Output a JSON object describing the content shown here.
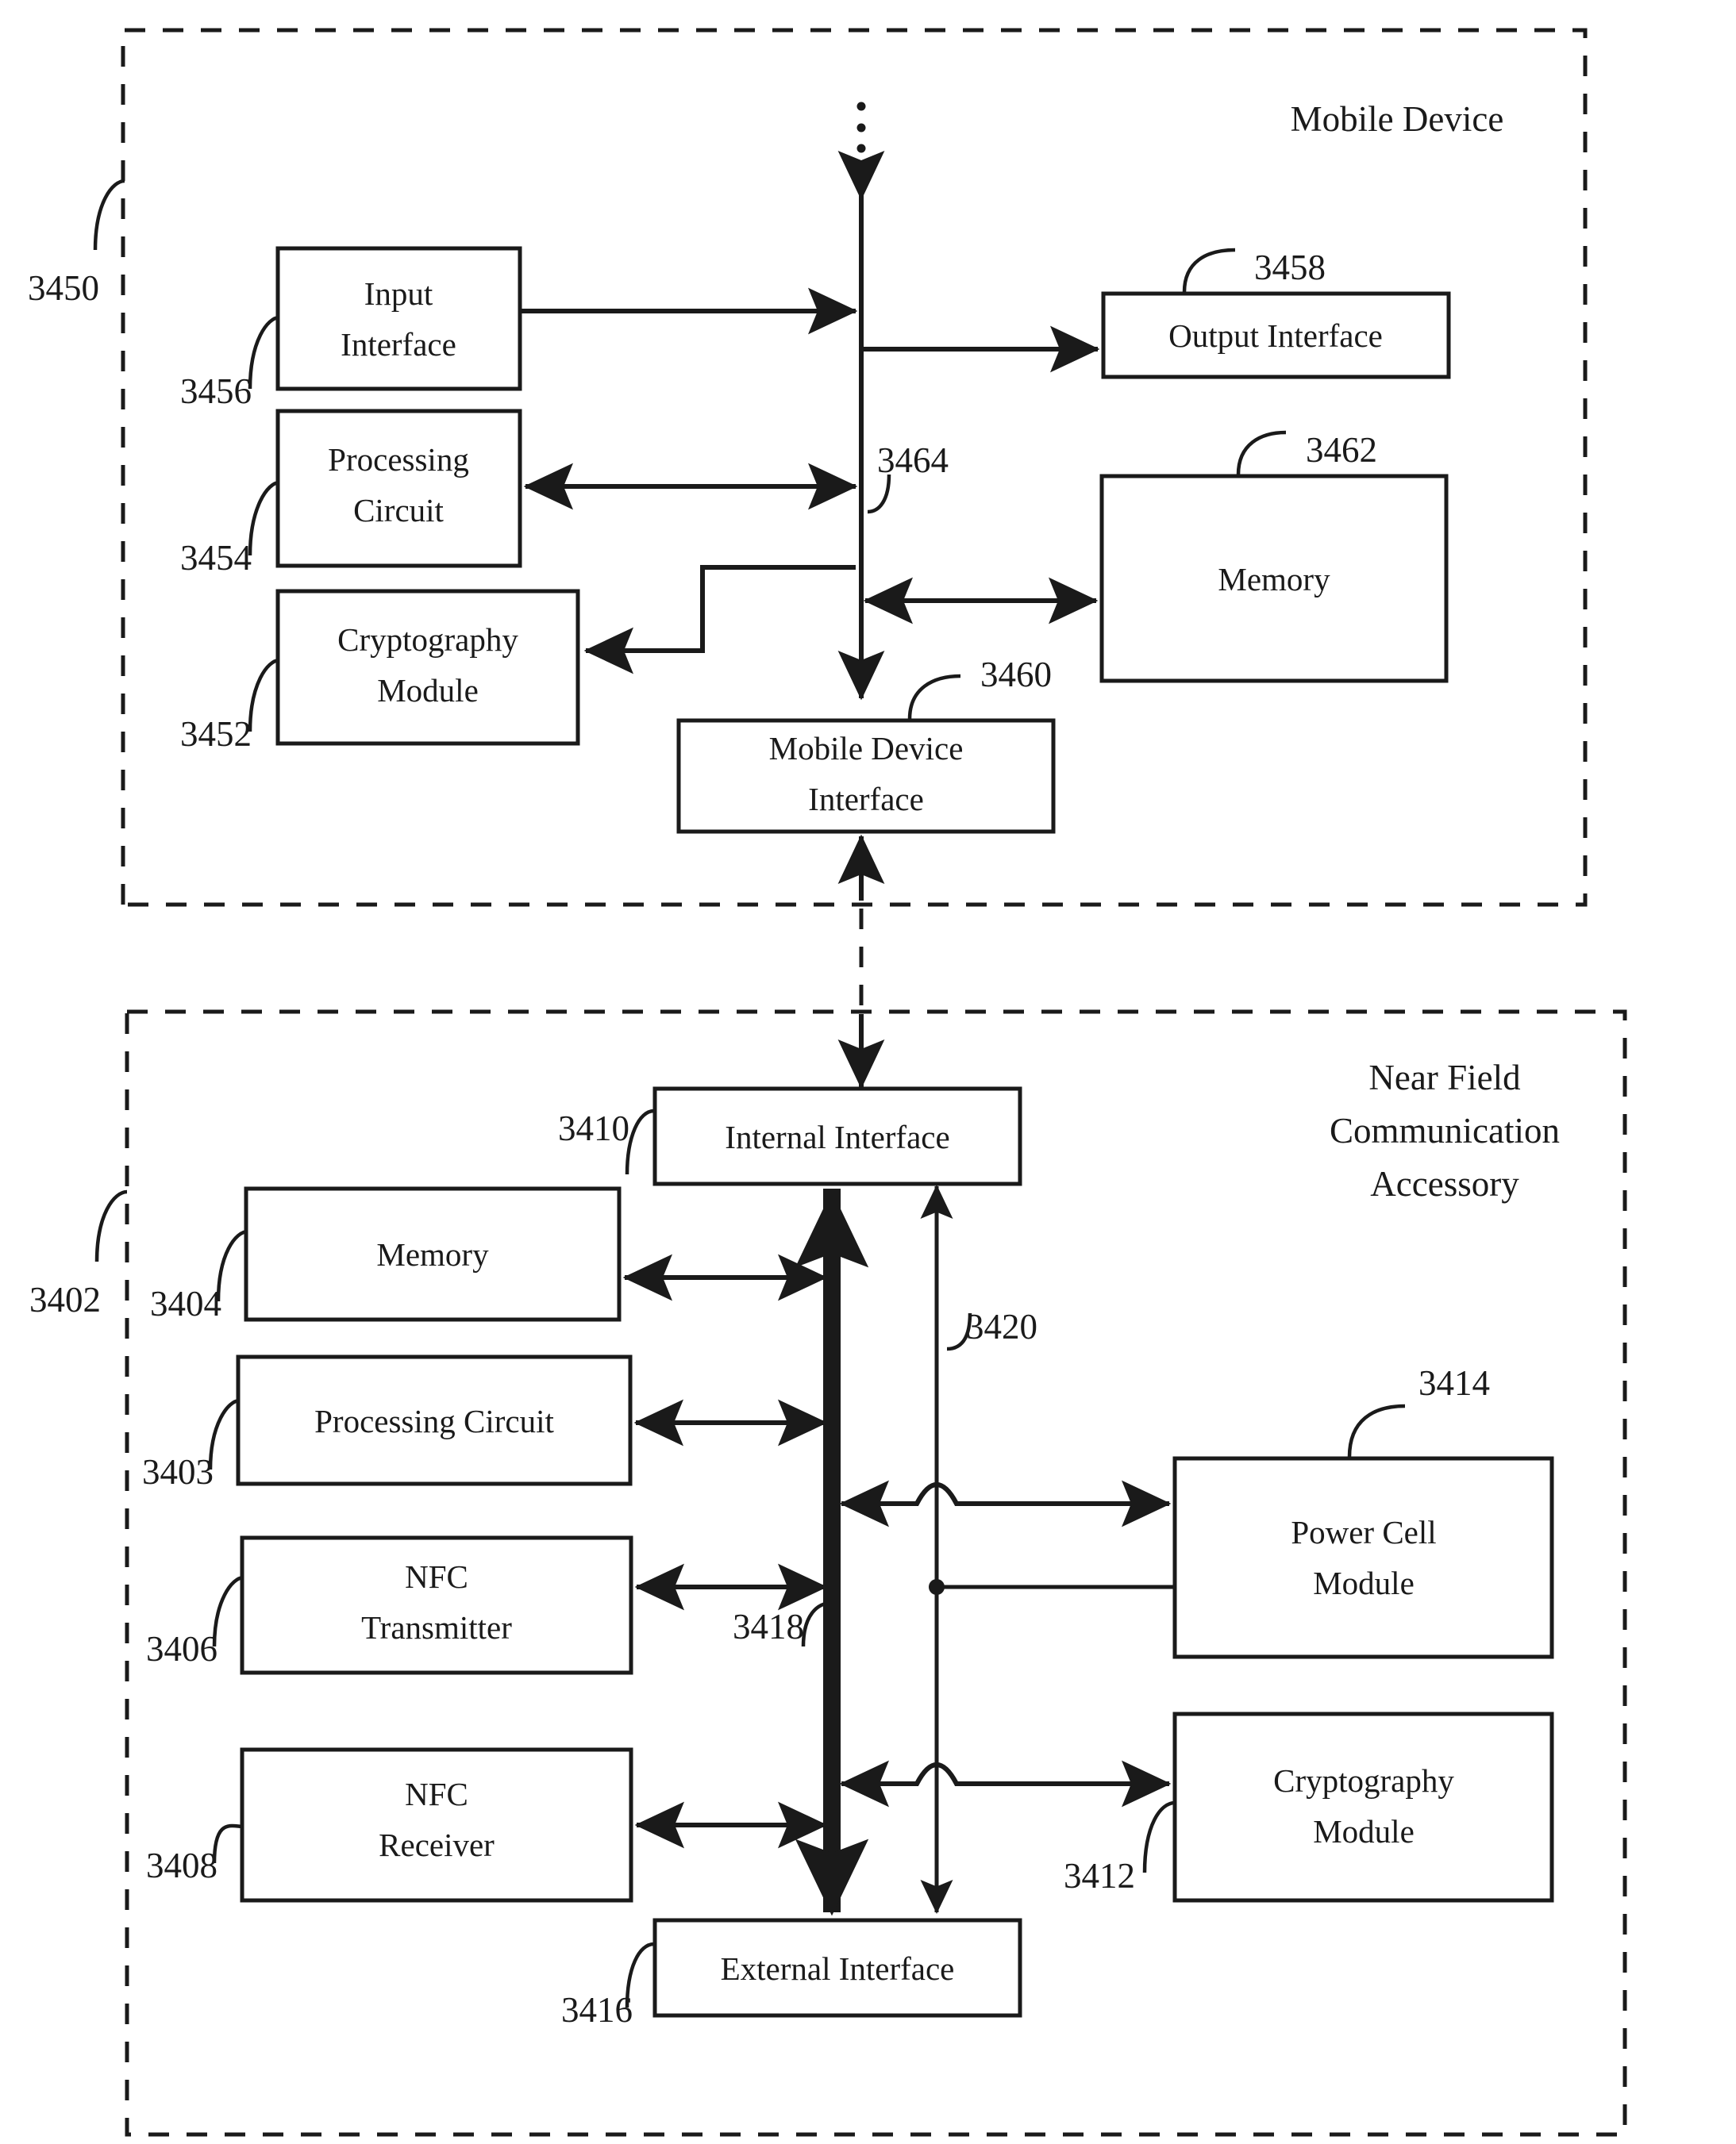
{
  "figure": {
    "type": "patent-block-diagram",
    "sections": [
      {
        "id": "mobile-device",
        "title": "Mobile Device",
        "ref": "3450"
      },
      {
        "id": "nfc-accessory",
        "title": "Near Field\nCommunication\nAccessory",
        "ref": "3402"
      }
    ]
  },
  "mobile_device": {
    "title_line": "Mobile Device",
    "ref": "3450",
    "blocks": {
      "input_interface": {
        "label_line1": "Input",
        "label_line2": "Interface",
        "ref": "3456"
      },
      "processing_circuit": {
        "label_line1": "Processing",
        "label_line2": "Circuit",
        "ref": "3454"
      },
      "cryptography_module": {
        "label_line1": "Cryptography",
        "label_line2": "Module",
        "ref": "3452"
      },
      "output_interface": {
        "label_line1": "Output Interface",
        "label_line2": "",
        "ref": "3458"
      },
      "memory": {
        "label_line1": "Memory",
        "label_line2": "",
        "ref": "3462"
      },
      "mobile_device_interface": {
        "label_line1": "Mobile Device",
        "label_line2": "Interface",
        "ref": "3460"
      },
      "bus": {
        "ref": "3464"
      }
    },
    "ellipsis": "⋮"
  },
  "nfc_accessory": {
    "title_line1": "Near Field",
    "title_line2": "Communication",
    "title_line3": "Accessory",
    "ref": "3402",
    "blocks": {
      "internal_interface": {
        "label_line1": "Internal Interface",
        "label_line2": "",
        "ref": "3410"
      },
      "memory": {
        "label_line1": "Memory",
        "label_line2": "",
        "ref": "3404"
      },
      "processing_circuit": {
        "label_line1": "Processing Circuit",
        "label_line2": "",
        "ref": "3403"
      },
      "nfc_transmitter": {
        "label_line1": "NFC",
        "label_line2": "Transmitter",
        "ref": "3406"
      },
      "nfc_receiver": {
        "label_line1": "NFC",
        "label_line2": "Receiver",
        "ref": "3408"
      },
      "power_cell_module": {
        "label_line1": "Power Cell",
        "label_line2": "Module",
        "ref": "3414"
      },
      "cryptography_module": {
        "label_line1": "Cryptography",
        "label_line2": "Module",
        "ref": "3412"
      },
      "external_interface": {
        "label_line1": "External Interface",
        "label_line2": "",
        "ref": "3416"
      },
      "data_bus": {
        "ref": "3418"
      },
      "power_bus": {
        "ref": "3420"
      }
    }
  },
  "colors": {
    "ink": "#1a1a1a",
    "paper": "#ffffff"
  }
}
